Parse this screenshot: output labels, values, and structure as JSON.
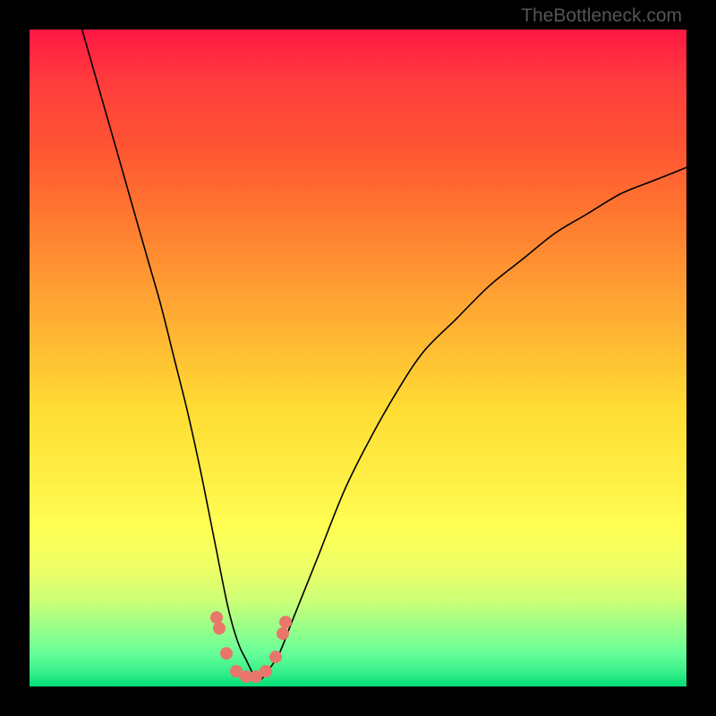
{
  "attribution": "TheBottleneck.com",
  "chart_data": {
    "type": "line",
    "title": "",
    "xlabel": "",
    "ylabel": "",
    "xlim": [
      0,
      100
    ],
    "ylim": [
      0,
      100
    ],
    "series": [
      {
        "name": "bottleneck-curve",
        "x": [
          8,
          10,
          12,
          14,
          16,
          18,
          20,
          22,
          24,
          26,
          28,
          30,
          31,
          32,
          33,
          34,
          35,
          36,
          38,
          40,
          44,
          48,
          52,
          56,
          60,
          65,
          70,
          75,
          80,
          85,
          90,
          95,
          100
        ],
        "values": [
          100,
          93,
          86,
          79,
          72,
          65,
          58,
          50,
          42,
          33,
          23,
          13,
          9,
          6,
          4,
          2,
          1,
          2,
          5,
          10,
          20,
          30,
          38,
          45,
          51,
          56,
          61,
          65,
          69,
          72,
          75,
          77,
          79
        ]
      }
    ],
    "markers": {
      "name": "highlight-points",
      "color": "#e8766b",
      "points": [
        {
          "x": 28.5,
          "y": 10.5
        },
        {
          "x": 28.9,
          "y": 8.8
        },
        {
          "x": 30.0,
          "y": 5.0
        },
        {
          "x": 31.5,
          "y": 2.3
        },
        {
          "x": 33.0,
          "y": 1.5
        },
        {
          "x": 34.5,
          "y": 1.5
        },
        {
          "x": 36.0,
          "y": 2.3
        },
        {
          "x": 37.5,
          "y": 4.5
        },
        {
          "x": 38.5,
          "y": 8.0
        },
        {
          "x": 39.0,
          "y": 9.8
        }
      ]
    },
    "background_gradient": {
      "top": "#ff1744",
      "bottom": "#00dd77"
    }
  }
}
